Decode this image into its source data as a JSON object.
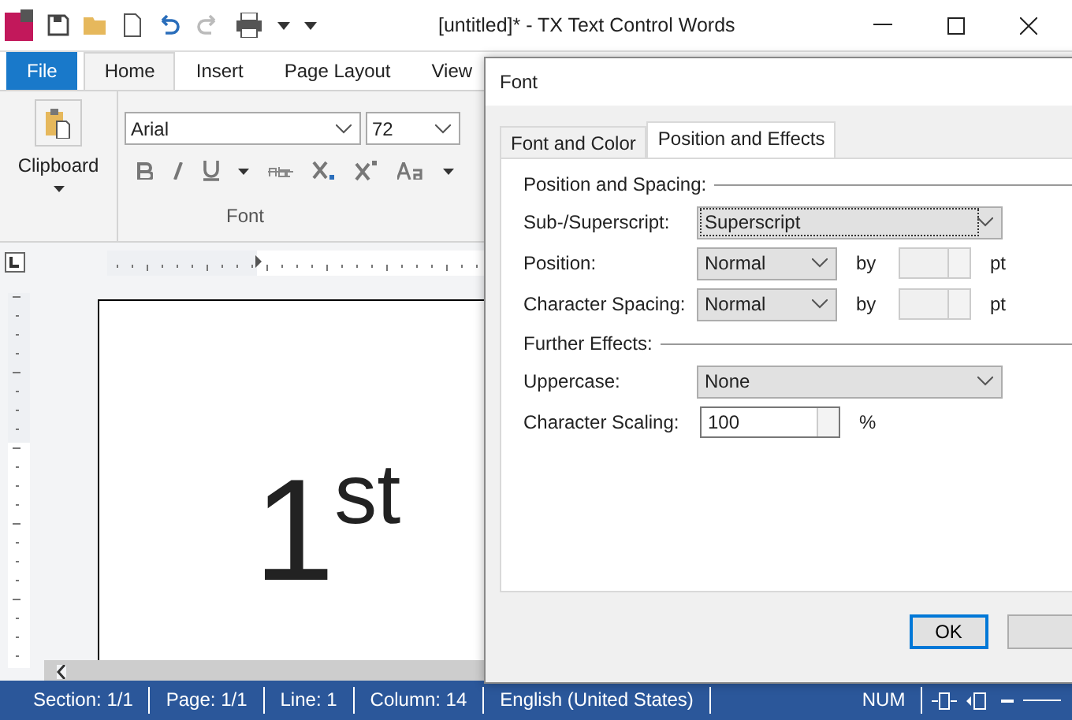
{
  "window": {
    "title": "[untitled]* - TX Text Control Words"
  },
  "ribbon_tabs": [
    {
      "label": "File",
      "kind": "file",
      "selected": false
    },
    {
      "label": "Home",
      "kind": "tab",
      "selected": true
    },
    {
      "label": "Insert",
      "kind": "tab",
      "selected": false
    },
    {
      "label": "Page Layout",
      "kind": "tab",
      "selected": false
    },
    {
      "label": "View",
      "kind": "tab",
      "selected": false
    }
  ],
  "ribbon": {
    "clipboard_label": "Clipboard",
    "font_name": "Arial",
    "font_size": "72",
    "font_group_label": "Font"
  },
  "document": {
    "text": "1$^{st}$"
  },
  "dialog": {
    "title": "Font",
    "tabs": [
      {
        "label": "Font and Color",
        "selected": false
      },
      {
        "label": "Position and Effects",
        "selected": true
      }
    ],
    "groups": [
      {
        "title": "Position and Spacing:",
        "rows": [
          {
            "kind": "combo",
            "label": "Sub-/Superscript:",
            "value": "Superscript",
            "focused": true
          },
          {
            "kind": "combo_by",
            "label": "Position:",
            "value": "Normal",
            "by": "by",
            "unit": "pt",
            "disabled": true
          },
          {
            "kind": "combo_by",
            "label": "Character Spacing:",
            "value": "Normal",
            "by": "by",
            "unit": "pt",
            "disabled": true
          }
        ]
      },
      {
        "title": "Further Effects:",
        "rows": [
          {
            "kind": "combo",
            "label": "Uppercase:",
            "value": "None",
            "focused": false
          },
          {
            "kind": "spin",
            "label": "Character Scaling:",
            "value": "100",
            "unit": "%"
          }
        ]
      }
    ],
    "ok_button": "OK"
  },
  "status_bar": {
    "items": [
      "Section: 1/1",
      "Page: 1/1",
      "Line: 1",
      "Column: 14",
      "English (United States)",
      "NUM"
    ]
  }
}
